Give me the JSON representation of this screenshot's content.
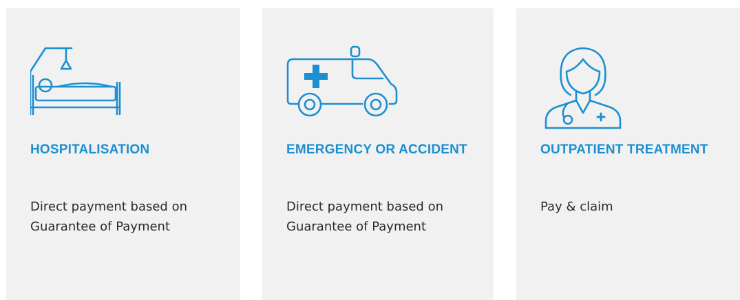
{
  "accent_color": "#1b8fd2",
  "cards": [
    {
      "icon": "hospital-bed-icon",
      "title": "HOSPITALISATION",
      "description": "Direct payment based on Guarantee of Payment"
    },
    {
      "icon": "ambulance-icon",
      "title": "EMERGENCY OR ACCIDENT",
      "description": "Direct payment based on Guarantee of Payment"
    },
    {
      "icon": "doctor-icon",
      "title": "OUTPATIENT TREATMENT",
      "description": "Pay & claim"
    }
  ]
}
